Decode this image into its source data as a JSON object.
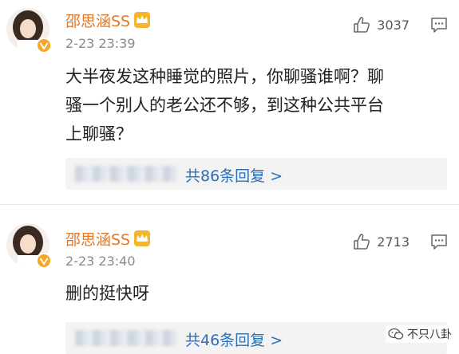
{
  "comments": [
    {
      "username": "邵思涵SS",
      "timestamp": "2-23 23:39",
      "likes": "3037",
      "text_lines": [
        "大半夜发这种睡觉的照片，你聊骚谁啊？聊",
        "骚一个别人的老公还不够，到这种公共平台",
        "上聊骚？"
      ],
      "replies": "共86条回复 >"
    },
    {
      "username": "邵思涵SS",
      "timestamp": "2-23 23:40",
      "likes": "2713",
      "text_lines": [
        "删的挺快呀"
      ],
      "replies": "共46条回复 >"
    }
  ],
  "watermark": "不只八卦",
  "colors": {
    "username": "#e0792a",
    "reply_link": "#2d6fb5",
    "verify": "#f5a623"
  },
  "icons": [
    "thumbs-up-icon",
    "comment-icon",
    "verified-badge-icon",
    "crown-icon",
    "wechat-icon"
  ]
}
